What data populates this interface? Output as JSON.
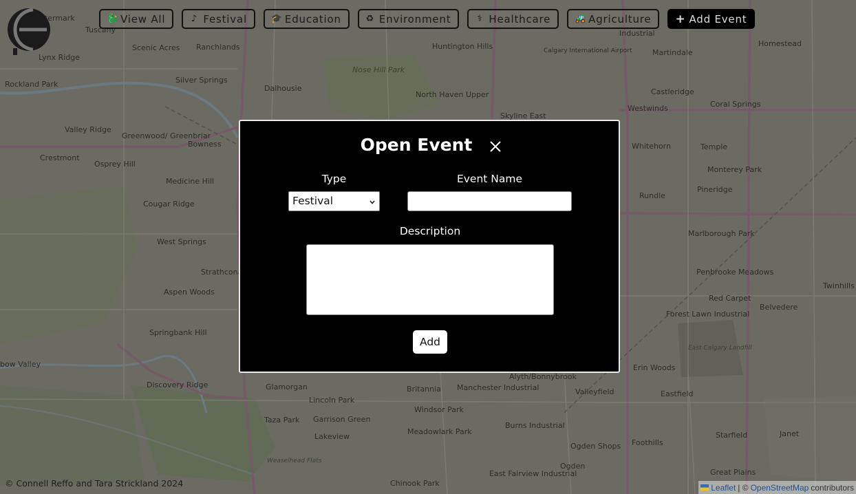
{
  "toolbar": {
    "buttons": [
      {
        "icon": "🐉",
        "label": "View All"
      },
      {
        "icon": "♪",
        "label": "Festival"
      },
      {
        "icon": "🎓",
        "label": "Education"
      },
      {
        "icon": "♻",
        "label": "Environment"
      },
      {
        "icon": "⚕",
        "label": "Healthcare"
      },
      {
        "icon": "🚜",
        "label": "Agriculture"
      },
      {
        "icon": "+",
        "label": "Add Event"
      }
    ]
  },
  "modal": {
    "title": "Open Event",
    "type_label": "Type",
    "type_selected": "Festival",
    "name_label": "Event Name",
    "name_value": "",
    "description_label": "Description",
    "description_value": "",
    "add_label": "Add"
  },
  "footer": {
    "credit": "© Connell Reffo and Tara Strickland 2024",
    "leaflet": "Leaflet",
    "separator": " | © ",
    "osm": "OpenStreetMap",
    "contributors": "contributors"
  },
  "map": {
    "labels": [
      "Watermark",
      "Tuscany",
      "Scenic Acres",
      "Ranchlands",
      "Lynx Ridge",
      "Rockland Park",
      "Silver Springs",
      "Dalhousie",
      "Huntington Hills",
      "North Haven Upper",
      "Nose Hill Park",
      "Calgary International Airport",
      "Industrial",
      "Martindale",
      "Homestead",
      "Castleridge",
      "Coral Springs",
      "Westwinds",
      "Skyline East",
      "Valley Ridge",
      "Greenwood/ Greenbriar",
      "Bowness",
      "Crestmont",
      "Osprey Hill",
      "Medicine Hill",
      "Cougar Ridge",
      "West Springs",
      "Aspen Woods",
      "Strathcona Park",
      "Springbank Hill",
      "Discovery Ridge",
      "Whitehorn",
      "Temple",
      "Monterey Park",
      "Pineridge",
      "Rundle",
      "Marlborough Park",
      "Penbrooke Meadows",
      "Red Carpet",
      "Forest Lawn Industrial",
      "Belvedere",
      "Twinhills",
      "Erin Woods",
      "Eastfield",
      "East Calgary Landfill",
      "Glamorgan",
      "Lincoln Park",
      "Britannia",
      "Manchester Industrial",
      "Valleyfield",
      "Taza Park",
      "Garrison Green",
      "Windsor Park",
      "Lakeview",
      "Meadowlark Park",
      "Burns Industrial",
      "Ogden Shops",
      "Foothills",
      "Starfield",
      "Janet",
      "Ogden",
      "Chinook Park",
      "East Fairview Industrial",
      "Great Plains",
      "Weaselhead Flats",
      "bow Valley",
      "Alyth/Bonnybrook"
    ]
  }
}
